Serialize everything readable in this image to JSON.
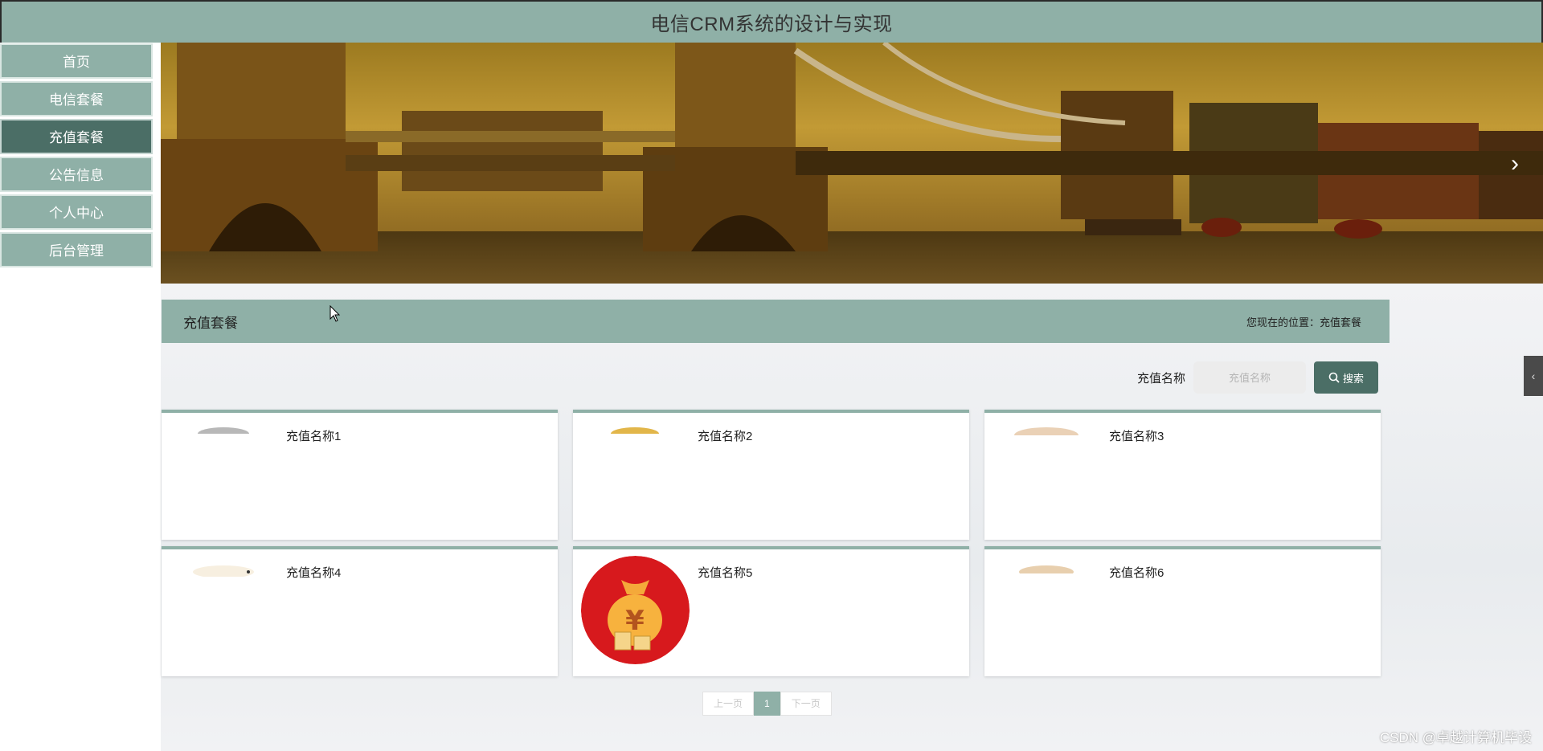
{
  "header": {
    "title": "电信CRM系统的设计与实现"
  },
  "sidebar": {
    "items": [
      {
        "label": "首页"
      },
      {
        "label": "电信套餐"
      },
      {
        "label": "充值套餐"
      },
      {
        "label": "公告信息"
      },
      {
        "label": "个人中心"
      },
      {
        "label": "后台管理"
      }
    ],
    "active_index": 2
  },
  "banner": {
    "next_icon": "chevron-right-icon"
  },
  "section": {
    "title": "充值套餐",
    "breadcrumb": "您现在的位置：充值套餐"
  },
  "search": {
    "label": "充值名称",
    "placeholder": "充值名称",
    "button_label": "搜索",
    "button_icon": "search-icon"
  },
  "cards": [
    {
      "title": "充值名称1"
    },
    {
      "title": "充值名称2"
    },
    {
      "title": "充值名称3"
    },
    {
      "title": "充值名称4"
    },
    {
      "title": "充值名称5"
    },
    {
      "title": "充值名称6"
    }
  ],
  "pagination": {
    "prev_label": "上一页",
    "current_page": "1",
    "next_label": "下一页"
  },
  "collapse_icon": "chevron-left-icon",
  "watermark": "CSDN @卓越计算机毕设",
  "colors": {
    "accent": "#8fb0a7",
    "accent_dark": "#4b6e66"
  }
}
